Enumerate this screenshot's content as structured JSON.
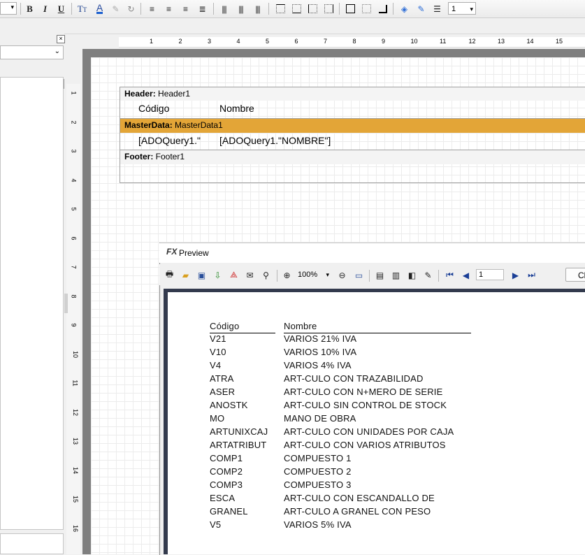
{
  "toolbar": {
    "bold_label": "B",
    "italic_label": "I",
    "underline_label": "U",
    "frame_width": "1"
  },
  "design": {
    "header_band": {
      "kind": "Header:",
      "name": "Header1"
    },
    "header_fields": [
      "Código",
      "Nombre"
    ],
    "master_band": {
      "kind": "MasterData:",
      "name": "MasterData1"
    },
    "master_fields": [
      "[ADOQuery1.\"",
      "[ADOQuery1.\"NOMBRE\"]"
    ],
    "footer_band": {
      "kind": "Footer:",
      "name": "Footer1"
    },
    "ruler_labels": [
      "1",
      "2",
      "3",
      "4",
      "5",
      "6",
      "7",
      "8",
      "9",
      "10",
      "11",
      "12",
      "13",
      "14",
      "15"
    ],
    "vruler_labels": [
      "1",
      "2",
      "3",
      "4",
      "5",
      "6",
      "7",
      "8",
      "9",
      "10",
      "11",
      "12",
      "13",
      "14",
      "15",
      "16"
    ],
    "colors": {
      "master_band": "#e3a537",
      "design_bg": "#7f7f7f"
    }
  },
  "preview": {
    "title": "Preview",
    "logo": "FX",
    "zoom": "100%",
    "page_number": "1",
    "close_label": "Cl",
    "columns": [
      "Código",
      "Nombre"
    ],
    "rows": [
      [
        "V21",
        "VARIOS 21% IVA"
      ],
      [
        "V10",
        "VARIOS 10% IVA"
      ],
      [
        "V4",
        "VARIOS 4% IVA"
      ],
      [
        "ATRA",
        "ART-CULO CON TRAZABILIDAD"
      ],
      [
        "ASER",
        "ART-CULO CON N+MERO DE SERIE"
      ],
      [
        "ANOSTK",
        "ART-CULO SIN CONTROL DE STOCK"
      ],
      [
        "MO",
        "MANO DE OBRA"
      ],
      [
        "ARTUNIXCAJ",
        "ART-CULO CON UNIDADES POR CAJA"
      ],
      [
        "ARTATRIBUT",
        "ART-CULO CON VARIOS ATRIBUTOS"
      ],
      [
        "COMP1",
        "COMPUESTO 1"
      ],
      [
        "COMP2",
        "COMPUESTO 2"
      ],
      [
        "COMP3",
        "COMPUESTO 3"
      ],
      [
        "ESCA",
        "ART-CULO CON ESCANDALLO DE"
      ],
      [
        "GRANEL",
        "ART-CULO A GRANEL CON PESO"
      ],
      [
        "V5",
        "VARIOS 5% IVA"
      ]
    ]
  }
}
